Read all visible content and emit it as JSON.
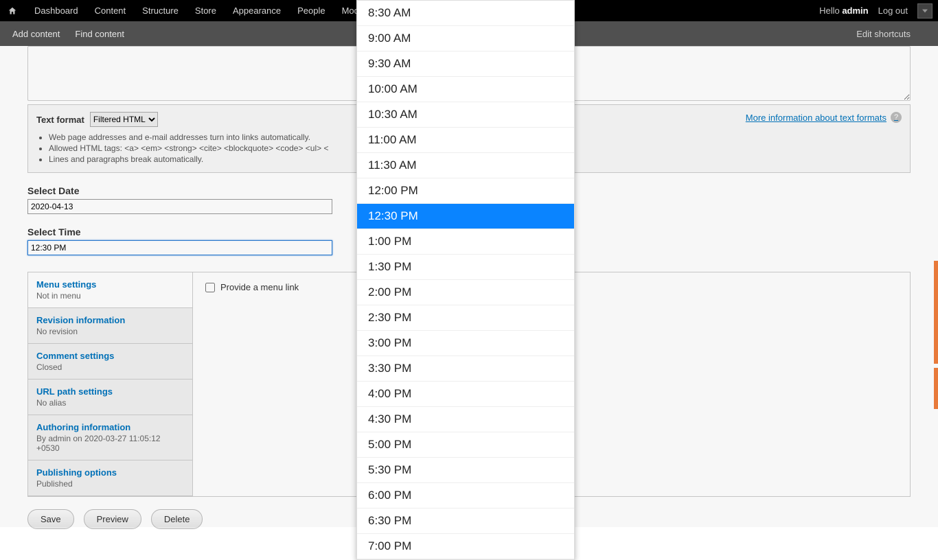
{
  "toolbar": {
    "items": [
      "Dashboard",
      "Content",
      "Structure",
      "Store",
      "Appearance",
      "People",
      "Modules"
    ],
    "hello": "Hello ",
    "user": "admin",
    "logout": "Log out"
  },
  "shortcuts": {
    "add": "Add content",
    "find": "Find content",
    "edit": "Edit shortcuts"
  },
  "format": {
    "label": "Text format",
    "selected": "Filtered HTML",
    "tips": [
      "Web page addresses and e-mail addresses turn into links automatically.",
      "Allowed HTML tags: <a> <em> <strong> <cite> <blockquote> <code> <ul> <",
      "Lines and paragraphs break automatically."
    ],
    "more": "More information about text formats"
  },
  "fields": {
    "date_label": "Select Date",
    "date_value": "2020-04-13",
    "time_label": "Select Time",
    "time_value": "12:30 PM"
  },
  "vtabs": [
    {
      "title": "Menu settings",
      "summary": "Not in menu",
      "active": true
    },
    {
      "title": "Revision information",
      "summary": "No revision"
    },
    {
      "title": "Comment settings",
      "summary": "Closed"
    },
    {
      "title": "URL path settings",
      "summary": "No alias"
    },
    {
      "title": "Authoring information",
      "summary": "By admin on 2020-03-27 11:05:12 +0530"
    },
    {
      "title": "Publishing options",
      "summary": "Published"
    }
  ],
  "menu_pane": {
    "checkbox": "Provide a menu link"
  },
  "buttons": {
    "save": "Save",
    "preview": "Preview",
    "delete": "Delete"
  },
  "time_options": [
    "8:30 AM",
    "9:00 AM",
    "9:30 AM",
    "10:00 AM",
    "10:30 AM",
    "11:00 AM",
    "11:30 AM",
    "12:00 PM",
    "12:30 PM",
    "1:00 PM",
    "1:30 PM",
    "2:00 PM",
    "2:30 PM",
    "3:00 PM",
    "3:30 PM",
    "4:00 PM",
    "4:30 PM",
    "5:00 PM",
    "5:30 PM",
    "6:00 PM",
    "6:30 PM",
    "7:00 PM"
  ],
  "time_selected_index": 8
}
